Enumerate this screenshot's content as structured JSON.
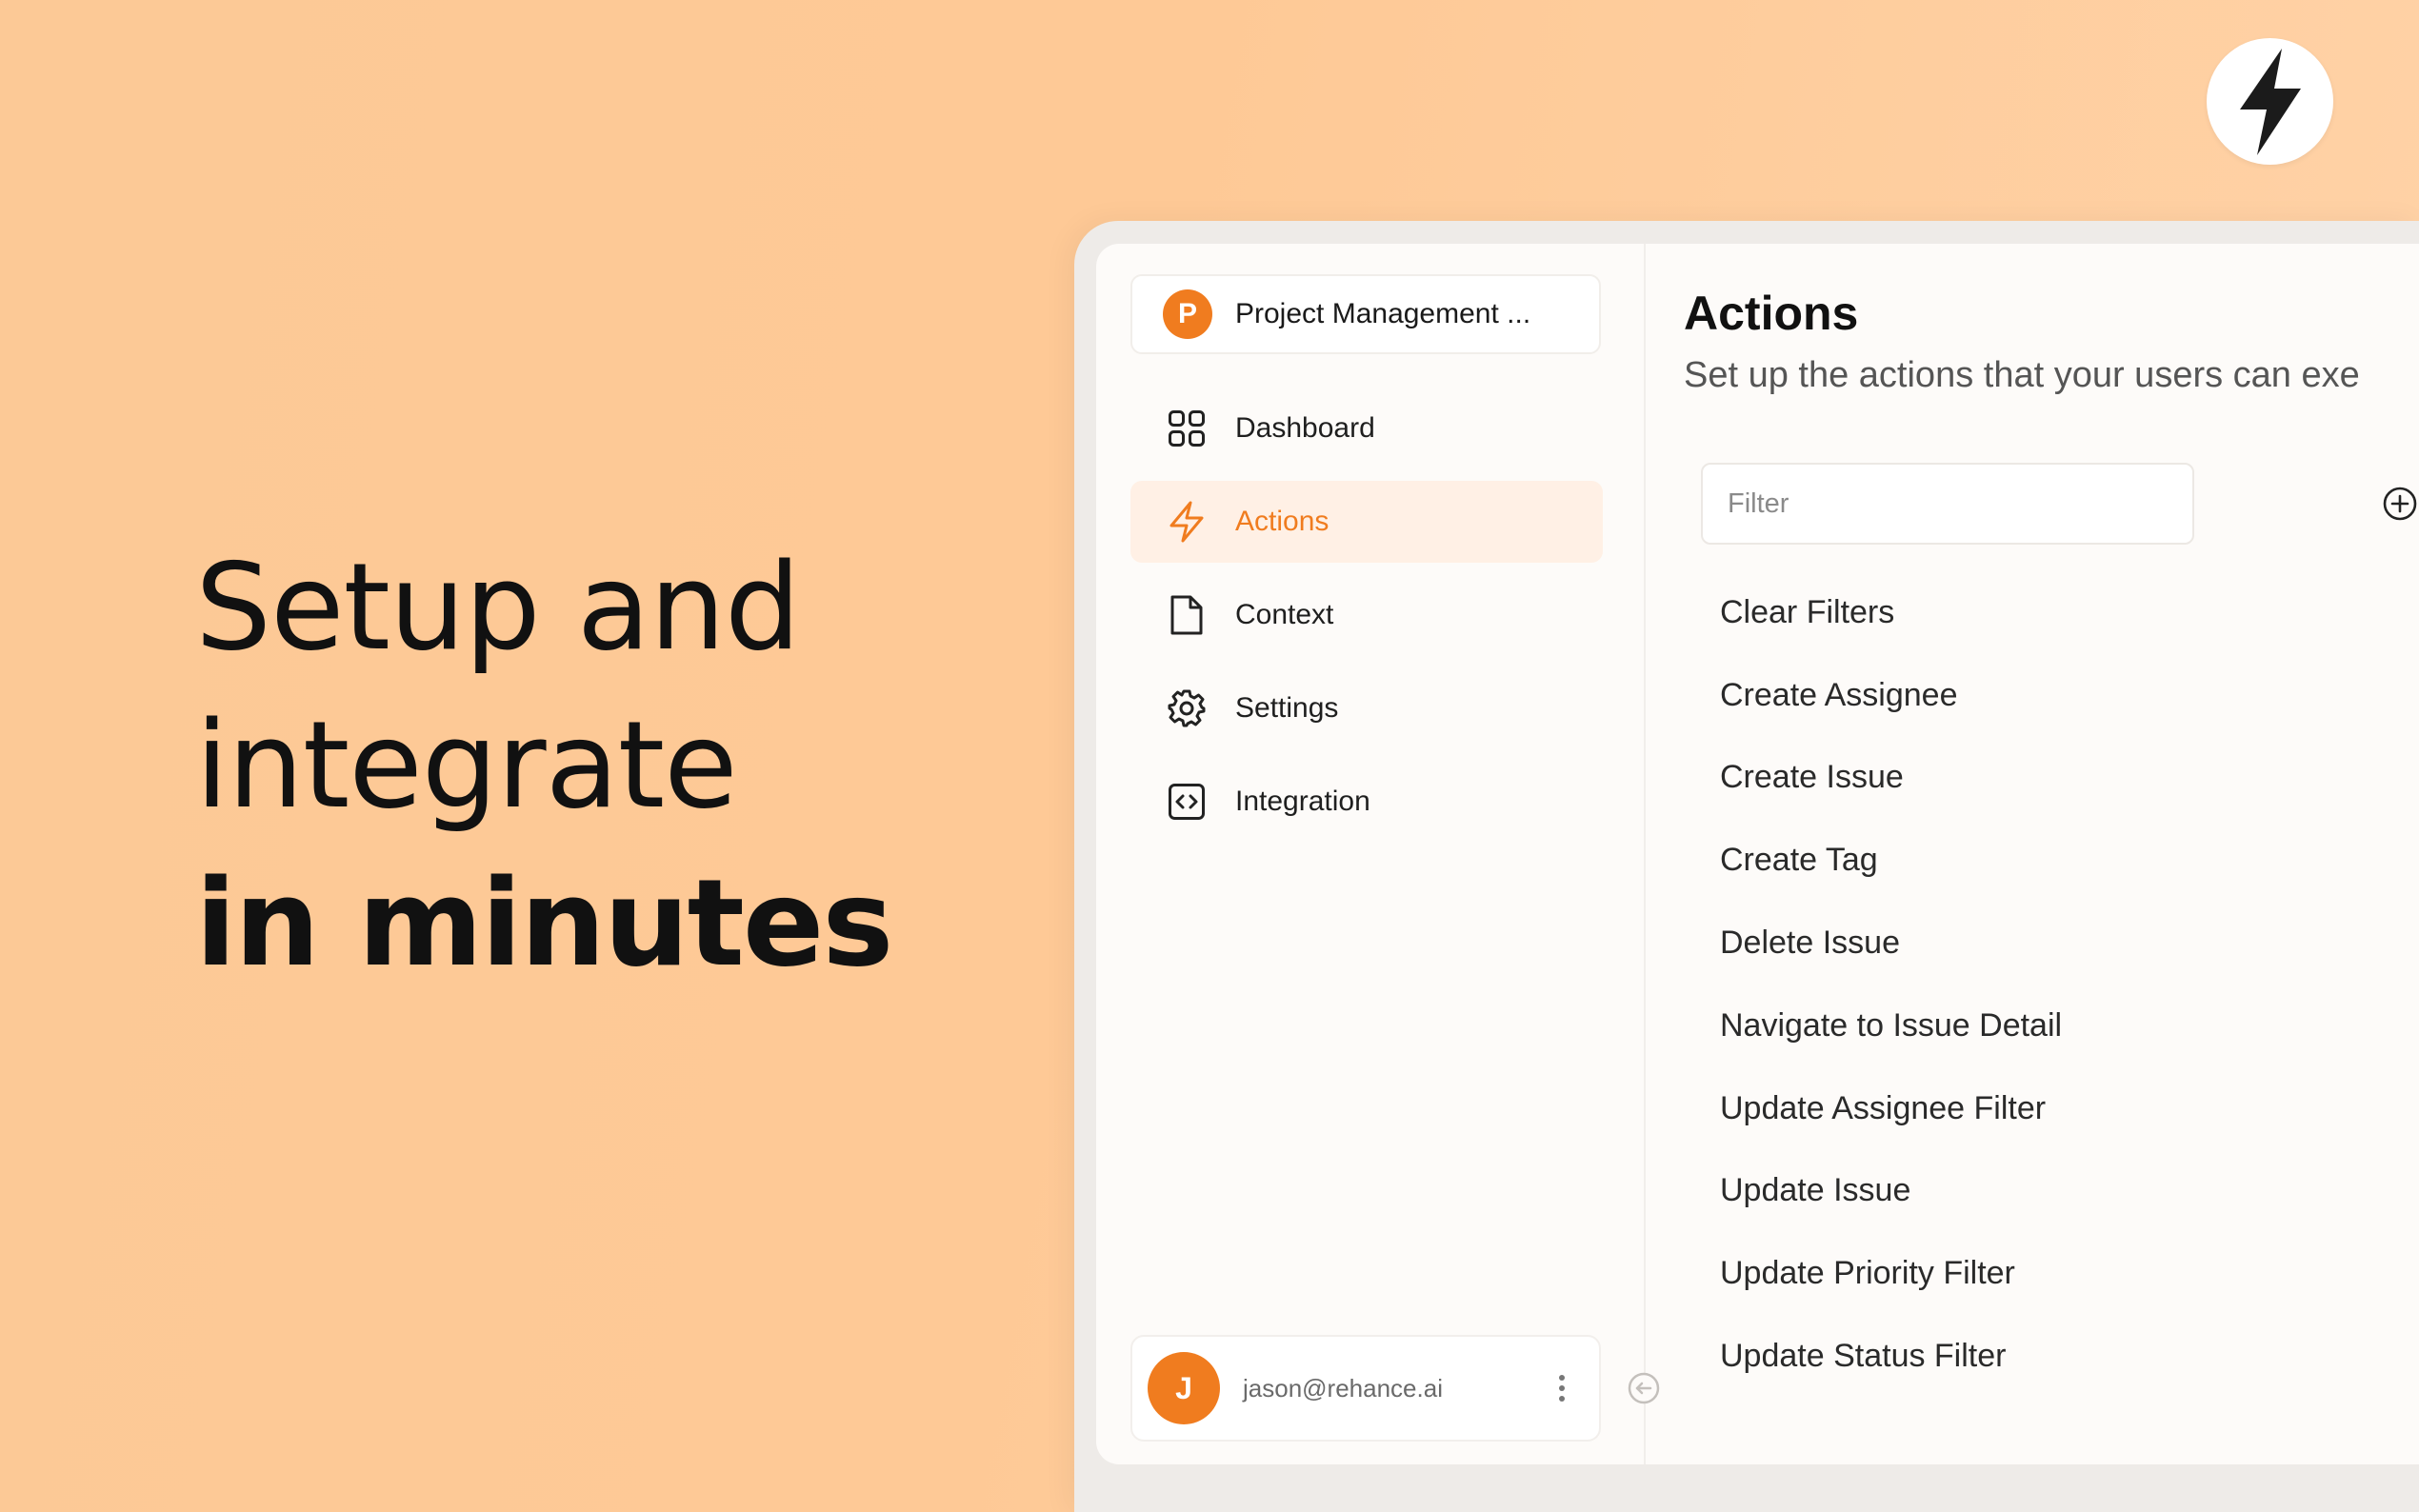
{
  "hero": {
    "line1": "Setup and",
    "line2": "integrate",
    "line3": "in minutes"
  },
  "logo": {
    "icon": "lightning-bolt-icon"
  },
  "sidebar": {
    "project": {
      "initial": "P",
      "name": "Project Management ..."
    },
    "nav": [
      {
        "label": "Dashboard",
        "icon": "dashboard-grid-icon",
        "active": false
      },
      {
        "label": "Actions",
        "icon": "lightning-icon",
        "active": true
      },
      {
        "label": "Context",
        "icon": "document-icon",
        "active": false
      },
      {
        "label": "Settings",
        "icon": "gear-icon",
        "active": false
      },
      {
        "label": "Integration",
        "icon": "code-brackets-icon",
        "active": false
      }
    ],
    "user": {
      "initial": "J",
      "email": "jason@rehance.ai"
    }
  },
  "main": {
    "title": "Actions",
    "subtitle": "Set up the actions that your users can exe",
    "filter": {
      "placeholder": "Filter",
      "value": ""
    },
    "actions": [
      "Clear Filters",
      "Create Assignee",
      "Create Issue",
      "Create Tag",
      "Delete Issue",
      "Navigate to Issue Detail",
      "Update Assignee Filter",
      "Update Issue",
      "Update Priority Filter",
      "Update Status Filter"
    ]
  },
  "colors": {
    "background": "#fec996",
    "accent": "#f07c1f",
    "active_bg": "#fff0e5",
    "text": "#111111"
  }
}
